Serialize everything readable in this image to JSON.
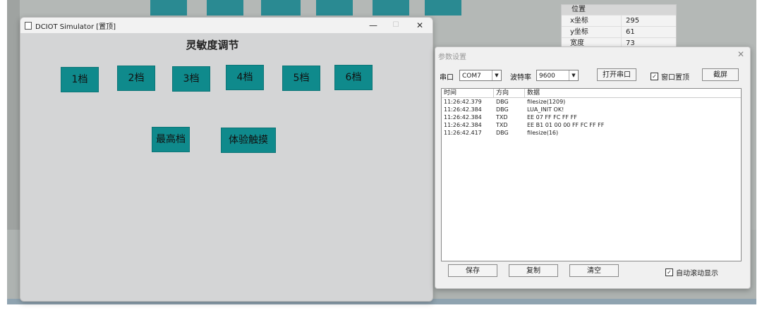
{
  "background": {
    "property_panel": {
      "section": "位置",
      "rows": [
        {
          "key": "x坐标",
          "value": "295"
        },
        {
          "key": "y坐标",
          "value": "61"
        },
        {
          "key": "宽度",
          "value": "73"
        }
      ]
    }
  },
  "simulator": {
    "title": "DCIOT Simulator [置顶]",
    "minimize": "—",
    "maximize": "☐",
    "close": "✕",
    "heading": "灵敏度调节",
    "level_buttons": [
      "1档",
      "2档",
      "3档",
      "4档",
      "5档",
      "6档"
    ],
    "max_button": "最高档",
    "experience_button": "体验触摸",
    "accent": "#0f8a8c"
  },
  "dialog": {
    "title": "参数设置",
    "close": "✕",
    "port_label": "串口",
    "port_value": "COM7",
    "baud_label": "波特率",
    "baud_value": "9600",
    "open_port": "打开串口",
    "on_top_label": "窗口置顶",
    "on_top_checked": "✓",
    "screenshot": "截屏",
    "log": {
      "columns": [
        "时间",
        "方向",
        "数据"
      ],
      "rows": [
        {
          "time": "11:26:42.379",
          "dir": "DBG",
          "data": "filesize(1209)"
        },
        {
          "time": "11:26:42.384",
          "dir": "DBG",
          "data": "LUA_INIT OK!"
        },
        {
          "time": "11:26:42.384",
          "dir": "TXD",
          "data": "EE 07 FF FC FF FF"
        },
        {
          "time": "11:26:42.384",
          "dir": "TXD",
          "data": "EE B1 01 00 00 FF FC FF FF"
        },
        {
          "time": "11:26:42.417",
          "dir": "DBG",
          "data": "filesize(16)"
        }
      ]
    },
    "save": "保存",
    "copy": "复制",
    "clear": "清空",
    "autoscroll_label": "自动滚动显示",
    "autoscroll_checked": "✓"
  }
}
